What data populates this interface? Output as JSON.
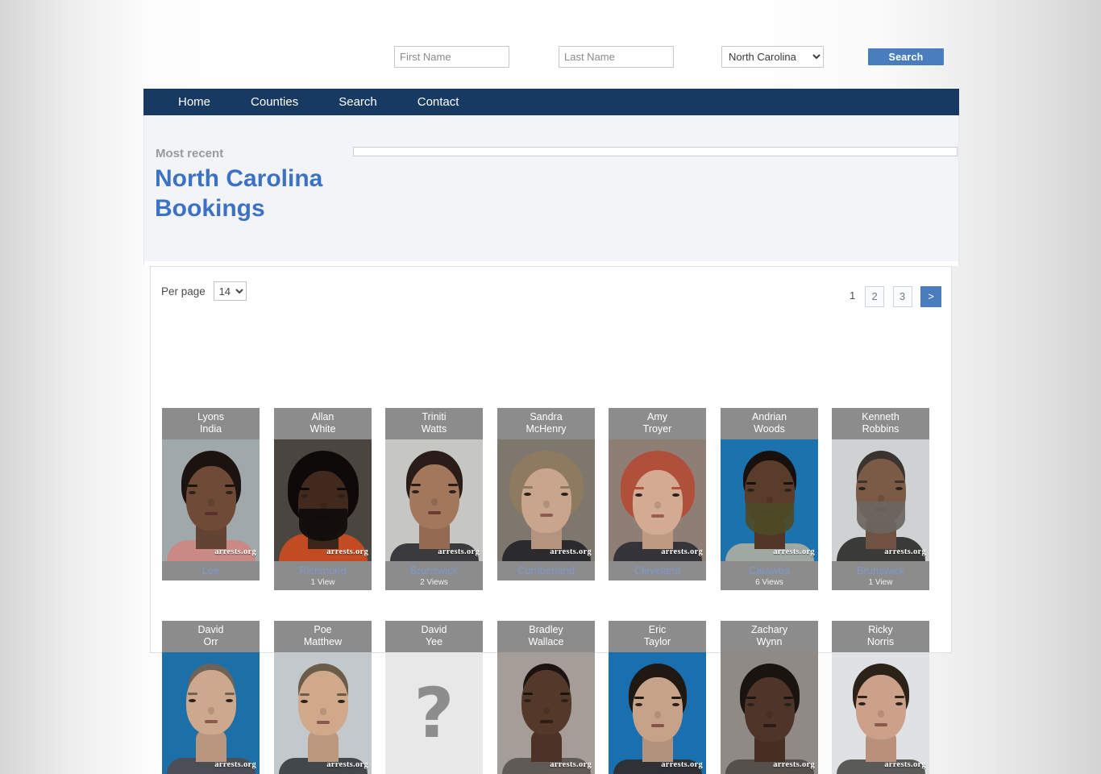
{
  "search_bar": {
    "first_name": {
      "placeholder": "First Name",
      "value": ""
    },
    "last_name": {
      "placeholder": "Last Name",
      "value": ""
    },
    "state_select": {
      "value": "North Carolina",
      "options": [
        "North Carolina"
      ]
    },
    "search_button": "Search"
  },
  "nav": {
    "items": [
      {
        "label": "Home"
      },
      {
        "label": "Counties"
      },
      {
        "label": "Search"
      },
      {
        "label": "Contact"
      }
    ]
  },
  "page_header": {
    "eyebrow": "Most recent",
    "title": "North Carolina Bookings"
  },
  "results_toolbar": {
    "per_page_label": "Per page",
    "per_page_value": "14",
    "per_page_options": [
      "14"
    ],
    "pagination": {
      "current": "1",
      "pages": [
        "2",
        "3"
      ],
      "next": ">"
    }
  },
  "colors": {
    "nav_bg": "#173a63",
    "accent_blue": "#4a7dbd",
    "title_blue": "#3c72c4",
    "card_grey": "#8c8c8c",
    "county_link": "#8097cc",
    "panel_bg": "#f2f4f7"
  },
  "watermark": "arrests.org",
  "cards": [
    {
      "first": "Lyons",
      "last": "India",
      "county": "Lee",
      "views": "",
      "photo": "photo-lyons-india"
    },
    {
      "first": "Allan",
      "last": "White",
      "county": "Richmond",
      "views": "1 View",
      "photo": "photo-allan-white"
    },
    {
      "first": "Triniti",
      "last": "Watts",
      "county": "Brunswick",
      "views": "2 Views",
      "photo": "photo-triniti-watts"
    },
    {
      "first": "Sandra",
      "last": "McHenry",
      "county": "Cumberland",
      "views": "",
      "photo": "photo-sandra-mchenry"
    },
    {
      "first": "Amy",
      "last": "Troyer",
      "county": "Cleveland",
      "views": "",
      "photo": "photo-amy-troyer"
    },
    {
      "first": "Andrian",
      "last": "Woods",
      "county": "Catawba",
      "views": "6 Views",
      "photo": "photo-andrian-woods"
    },
    {
      "first": "Kenneth",
      "last": "Robbins",
      "county": "Brunswick",
      "views": "1 View",
      "photo": "photo-kenneth-robbins"
    },
    {
      "first": "David",
      "last": "Orr",
      "county": "",
      "views": "",
      "photo": "photo-david-orr"
    },
    {
      "first": "Poe",
      "last": "Matthew",
      "county": "",
      "views": "",
      "photo": "photo-poe-matthew"
    },
    {
      "first": "David",
      "last": "Yee",
      "county": "",
      "views": "",
      "photo": "photo-placeholder-question"
    },
    {
      "first": "Bradley",
      "last": "Wallace",
      "county": "",
      "views": "",
      "photo": "photo-bradley-wallace"
    },
    {
      "first": "Eric",
      "last": "Taylor",
      "county": "",
      "views": "",
      "photo": "photo-eric-taylor"
    },
    {
      "first": "Zachary",
      "last": "Wynn",
      "county": "",
      "views": "",
      "photo": "photo-zachary-wynn"
    },
    {
      "first": "Ricky",
      "last": "Norris",
      "county": "",
      "views": "",
      "photo": "photo-ricky-norris"
    }
  ]
}
